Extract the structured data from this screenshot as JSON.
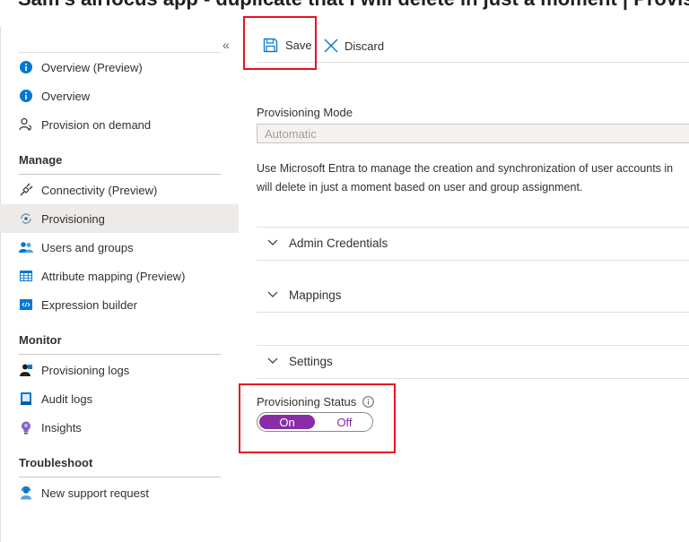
{
  "page": {
    "title": "Sam's airfocus app - duplicate that I will delete in just a moment | Provisioning"
  },
  "sidebar": {
    "collapse_icon": "double-chevron-left-icon",
    "items_top": [
      {
        "label": "Overview (Preview)",
        "icon": "info-icon"
      },
      {
        "label": "Overview",
        "icon": "info-icon"
      },
      {
        "label": "Provision on demand",
        "icon": "provision-user-icon"
      }
    ],
    "manage": {
      "heading": "Manage",
      "items": [
        {
          "label": "Connectivity (Preview)",
          "icon": "plug-icon"
        },
        {
          "label": "Provisioning",
          "icon": "provisioning-sync-icon",
          "active": true
        },
        {
          "label": "Users and groups",
          "icon": "users-icon"
        },
        {
          "label": "Attribute mapping (Preview)",
          "icon": "table-icon"
        },
        {
          "label": "Expression builder",
          "icon": "code-icon"
        }
      ]
    },
    "monitor": {
      "heading": "Monitor",
      "items": [
        {
          "label": "Provisioning logs",
          "icon": "log-user-icon"
        },
        {
          "label": "Audit logs",
          "icon": "audit-book-icon"
        },
        {
          "label": "Insights",
          "icon": "lightbulb-icon"
        }
      ]
    },
    "troubleshoot": {
      "heading": "Troubleshoot",
      "items": [
        {
          "label": "New support request",
          "icon": "support-person-icon"
        }
      ]
    }
  },
  "toolbar": {
    "save_label": "Save",
    "discard_label": "Discard"
  },
  "main": {
    "provisioning_mode": {
      "label": "Provisioning Mode",
      "value": "Automatic"
    },
    "description_line1": "Use Microsoft Entra to manage the creation and synchronization of user accounts in",
    "description_line2": "will delete in just a moment based on user and group assignment.",
    "sections": [
      "Admin Credentials",
      "Mappings",
      "Settings"
    ],
    "status": {
      "label": "Provisioning Status",
      "on_label": "On",
      "off_label": "Off",
      "selected": "On"
    }
  },
  "colors": {
    "accent": "#8a2ca8",
    "highlight_box": "#e81123",
    "link_blue": "#0078d4"
  }
}
